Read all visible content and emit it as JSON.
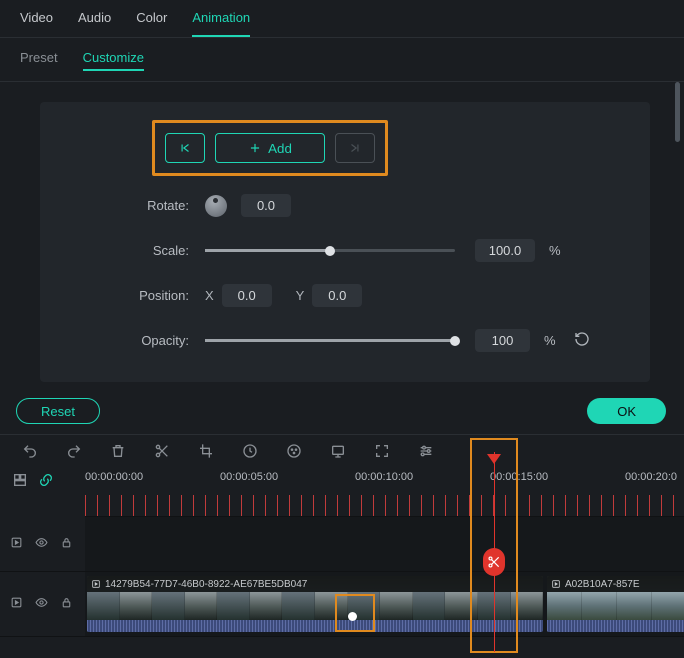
{
  "tabs": {
    "video": "Video",
    "audio": "Audio",
    "color": "Color",
    "animation": "Animation"
  },
  "subtabs": {
    "preset": "Preset",
    "customize": "Customize"
  },
  "keyframe": {
    "add": "Add"
  },
  "props": {
    "rotate": {
      "label": "Rotate:",
      "value": "0.0"
    },
    "scale": {
      "label": "Scale:",
      "value": "100.0",
      "pct": "%"
    },
    "position": {
      "label": "Position:",
      "xlabel": "X",
      "x": "0.0",
      "ylabel": "Y",
      "y": "0.0"
    },
    "opacity": {
      "label": "Opacity:",
      "value": "100",
      "pct": "%"
    }
  },
  "footer": {
    "reset": "Reset",
    "ok": "OK"
  },
  "timeline": {
    "timecodes": {
      "t0": "00:00:00:00",
      "t1": "00:00:05:00",
      "t2": "00:00:10:00",
      "t3": "00:00:15:00",
      "t4": "00:00:20:0"
    },
    "clip1_name": "14279B54-77D7-46B0-8922-AE67BE5DB047",
    "clip2_name": "A02B10A7-857E"
  }
}
